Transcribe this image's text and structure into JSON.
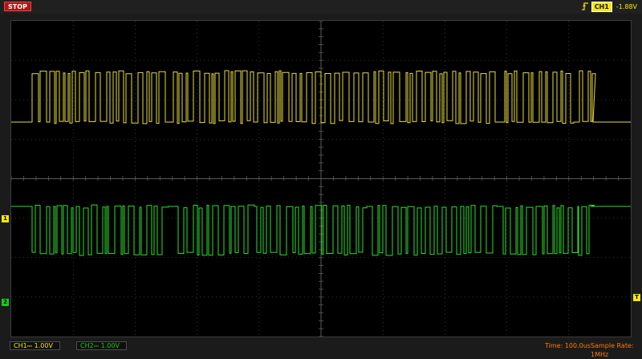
{
  "status": {
    "run_state": "STOP"
  },
  "trigger": {
    "channel": "CH1",
    "level": "-1.88V"
  },
  "markers": {
    "ch1": "1",
    "ch2": "2",
    "trigger": "T"
  },
  "channels": [
    {
      "name": "CH1",
      "scale": "1.00V",
      "color": "#f3ea00"
    },
    {
      "name": "CH2",
      "scale": "1.00V",
      "color": "#11d011"
    }
  ],
  "timebase": {
    "label": "Time: 100.0us"
  },
  "sample_rate": {
    "label": "Sample Rate: 1MHz"
  },
  "colors": {
    "grid": "#5a5a5a",
    "ch1_trace": "#e8dc3a",
    "ch2_trace": "#2ede2e",
    "stop": "#b01414"
  }
}
